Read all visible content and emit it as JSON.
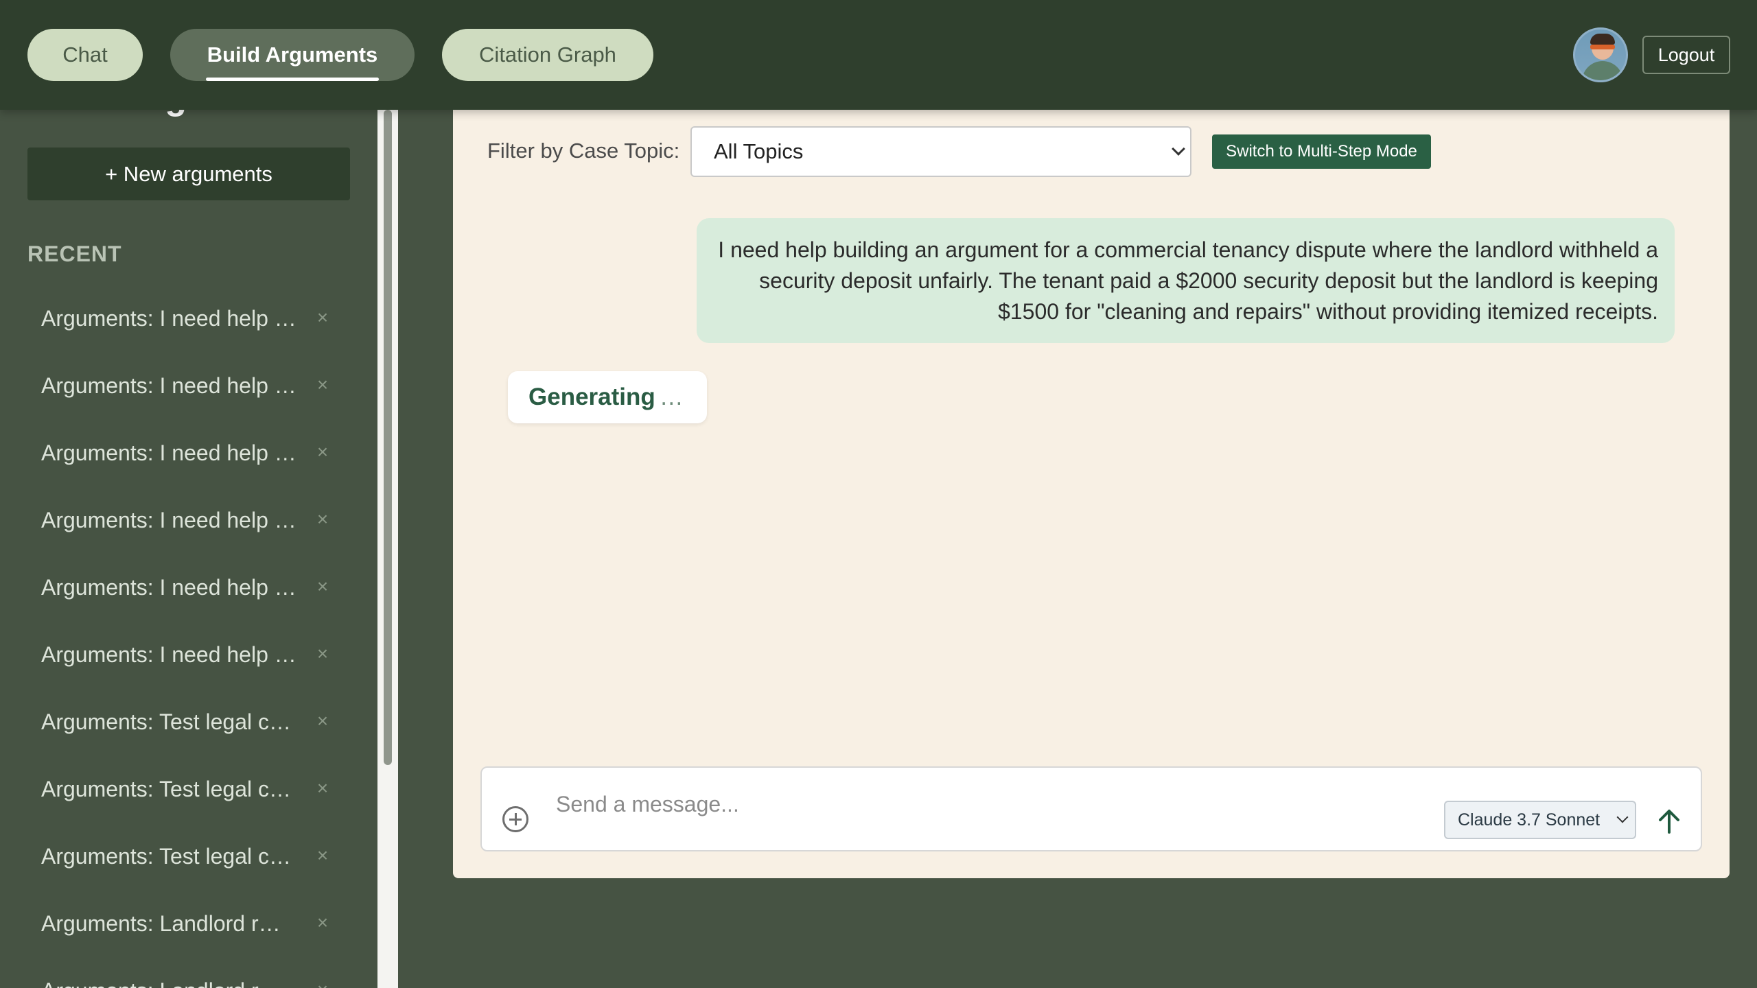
{
  "nav": {
    "tabs": [
      {
        "label": "Chat"
      },
      {
        "label": "Build Arguments"
      },
      {
        "label": "Citation Graph"
      }
    ],
    "logout_label": "Logout"
  },
  "sidebar": {
    "title": "Build Arguments",
    "new_button_label": "+ New arguments",
    "recent_label": "RECENT",
    "items": [
      {
        "label": "Arguments: I need help building an argument for a commercial tenancy dispute"
      },
      {
        "label": "Arguments: I need help building an argument for a commercial tenancy dispute"
      },
      {
        "label": "Arguments: I need help building an argument for a commercial tenancy dispute"
      },
      {
        "label": "Arguments: I need help building an argument for a commercial tenancy dispute"
      },
      {
        "label": "Arguments: I need help building an argument for a commercial tenancy dispute"
      },
      {
        "label": "Arguments: I need help building an argument for a commercial tenancy dispute"
      },
      {
        "label": "Arguments: Test legal case"
      },
      {
        "label": "Arguments: Test legal case"
      },
      {
        "label": "Arguments: Test legal case"
      },
      {
        "label": "Arguments: Landlord r…"
      },
      {
        "label": "Arguments: Landlord r…"
      }
    ],
    "remove_glyph": "×"
  },
  "main": {
    "filter_label": "Filter by Case Topic:",
    "topic_selected": "All Topics",
    "multistep_label": "Switch to Multi-Step Mode",
    "user_message": "I need help building an argument for a commercial tenancy dispute where the landlord withheld a security deposit unfairly. The tenant paid a $2000 security deposit but the landlord is keeping $1500 for \"cleaning and repairs\" without providing itemized receipts.",
    "generating_text": "Generating",
    "generating_dots": "…",
    "composer": {
      "placeholder": "Send a message...",
      "model_selected": "Claude 3.7 Sonnet"
    }
  },
  "colors": {
    "topbar": "#2f3f2d",
    "sidebar": "#465343",
    "panel": "#f8f0e4",
    "accent": "#2a6044",
    "user_bubble": "#d8ecdc"
  }
}
